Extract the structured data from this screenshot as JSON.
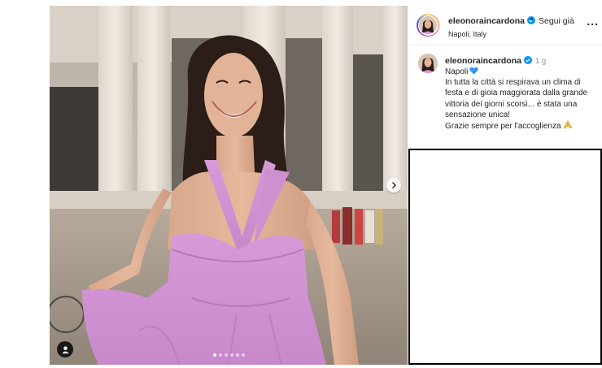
{
  "post": {
    "photo_alt": "",
    "carousel": {
      "count": 6,
      "active_index": 0
    }
  },
  "header": {
    "username": "eleonoraincardona",
    "separator": "•",
    "follow_label": "Segui già",
    "location": "Napoli, Italy",
    "more_label": "..."
  },
  "caption": {
    "username": "eleonoraincardona",
    "time": "1 g",
    "line1": "Napoli",
    "line2": "In tutta la città si respirava un clima di",
    "line3": "festa e di gioia maggiorata dalla grande",
    "line4": "vittoria dei giorni scorsi... è stata una",
    "line5": "sensazione unica!",
    "line6": "Grazie sempre per l'accoglienza"
  },
  "colors": {
    "verified_badge": "#0095f6",
    "heart_emoji": "#3897f0",
    "dress": "#d79ad8",
    "secondary_text": "#8e8e8e"
  },
  "icons": {
    "next": "chevron-right-icon",
    "tag": "user-tag-icon",
    "verified": "verified-badge-icon",
    "more": "more-options-icon"
  }
}
